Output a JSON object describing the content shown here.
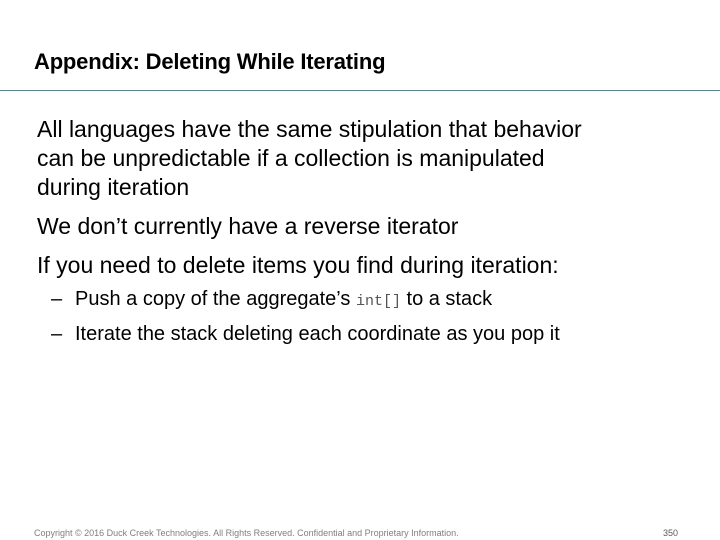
{
  "slide": {
    "title": "Appendix: Deleting While Iterating",
    "bullets": [
      {
        "lines": [
          "All languages have the same stipulation that behavior",
          "can be unpredictable if a collection is manipulated",
          "during iteration"
        ]
      },
      {
        "lines": [
          "We don’t currently have a reverse iterator"
        ]
      },
      {
        "lines": [
          "If you need to delete items you find during iteration:"
        ]
      }
    ],
    "subbullets": [
      {
        "dash": "–",
        "before": "Push a copy of the aggregate’s ",
        "code": "int[]",
        "after": " to a stack"
      },
      {
        "dash": "–",
        "text": "Iterate the stack deleting each coordinate as you pop it"
      }
    ],
    "footer": "Copyright © 2016 Duck Creek Technologies. All Rights Reserved. Confidential and Proprietary Information.",
    "page_number": "350"
  }
}
